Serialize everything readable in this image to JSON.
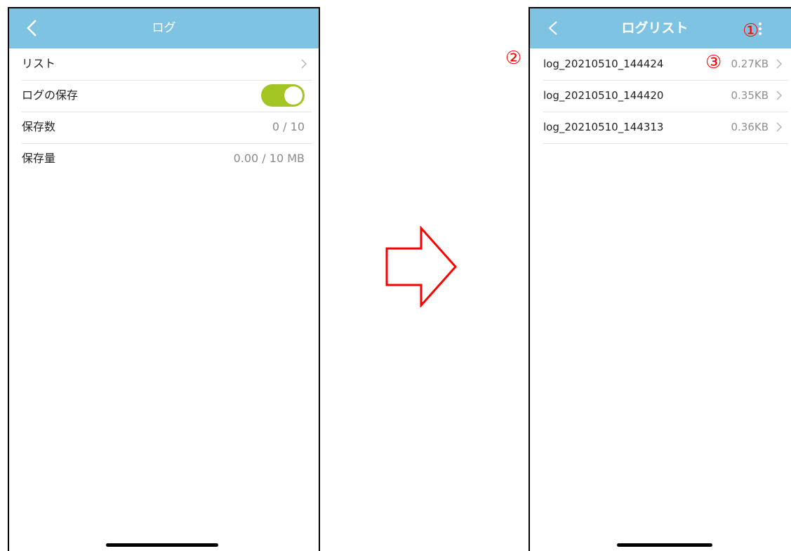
{
  "left_screen": {
    "title": "ログ",
    "rows": [
      {
        "label": "リスト",
        "value": ""
      },
      {
        "label": "ログの保存",
        "value": ""
      },
      {
        "label": "保存数",
        "value": "0 / 10"
      },
      {
        "label": "保存量",
        "value": "0.00 / 10 MB"
      }
    ],
    "toggle_on": true,
    "colors": {
      "header": "#7fc3e2",
      "toggle": "#a2c523"
    }
  },
  "right_screen": {
    "title": "ログリスト",
    "files": [
      {
        "name": "log_20210510_144424",
        "size": "0.27KB"
      },
      {
        "name": "log_20210510_144420",
        "size": "0.35KB"
      },
      {
        "name": "log_20210510_144313",
        "size": "0.36KB"
      }
    ]
  },
  "annotations": {
    "marker_1": "①",
    "marker_2": "②",
    "marker_3": "③",
    "color": "#ff0000"
  },
  "icons": [
    "back-chevron-icon",
    "chevron-right-icon",
    "kebab-menu-icon",
    "transition-arrow-icon"
  ]
}
